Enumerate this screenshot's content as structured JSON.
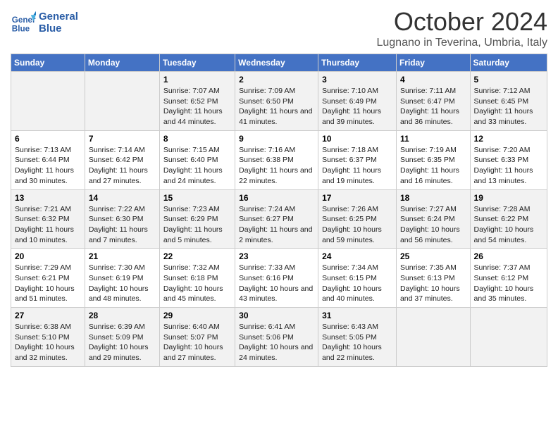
{
  "header": {
    "logo_line1": "General",
    "logo_line2": "Blue",
    "month": "October 2024",
    "location": "Lugnano in Teverina, Umbria, Italy"
  },
  "days_of_week": [
    "Sunday",
    "Monday",
    "Tuesday",
    "Wednesday",
    "Thursday",
    "Friday",
    "Saturday"
  ],
  "weeks": [
    [
      {
        "day": "",
        "info": ""
      },
      {
        "day": "",
        "info": ""
      },
      {
        "day": "1",
        "info": "Sunrise: 7:07 AM\nSunset: 6:52 PM\nDaylight: 11 hours and 44 minutes."
      },
      {
        "day": "2",
        "info": "Sunrise: 7:09 AM\nSunset: 6:50 PM\nDaylight: 11 hours and 41 minutes."
      },
      {
        "day": "3",
        "info": "Sunrise: 7:10 AM\nSunset: 6:49 PM\nDaylight: 11 hours and 39 minutes."
      },
      {
        "day": "4",
        "info": "Sunrise: 7:11 AM\nSunset: 6:47 PM\nDaylight: 11 hours and 36 minutes."
      },
      {
        "day": "5",
        "info": "Sunrise: 7:12 AM\nSunset: 6:45 PM\nDaylight: 11 hours and 33 minutes."
      }
    ],
    [
      {
        "day": "6",
        "info": "Sunrise: 7:13 AM\nSunset: 6:44 PM\nDaylight: 11 hours and 30 minutes."
      },
      {
        "day": "7",
        "info": "Sunrise: 7:14 AM\nSunset: 6:42 PM\nDaylight: 11 hours and 27 minutes."
      },
      {
        "day": "8",
        "info": "Sunrise: 7:15 AM\nSunset: 6:40 PM\nDaylight: 11 hours and 24 minutes."
      },
      {
        "day": "9",
        "info": "Sunrise: 7:16 AM\nSunset: 6:38 PM\nDaylight: 11 hours and 22 minutes."
      },
      {
        "day": "10",
        "info": "Sunrise: 7:18 AM\nSunset: 6:37 PM\nDaylight: 11 hours and 19 minutes."
      },
      {
        "day": "11",
        "info": "Sunrise: 7:19 AM\nSunset: 6:35 PM\nDaylight: 11 hours and 16 minutes."
      },
      {
        "day": "12",
        "info": "Sunrise: 7:20 AM\nSunset: 6:33 PM\nDaylight: 11 hours and 13 minutes."
      }
    ],
    [
      {
        "day": "13",
        "info": "Sunrise: 7:21 AM\nSunset: 6:32 PM\nDaylight: 11 hours and 10 minutes."
      },
      {
        "day": "14",
        "info": "Sunrise: 7:22 AM\nSunset: 6:30 PM\nDaylight: 11 hours and 7 minutes."
      },
      {
        "day": "15",
        "info": "Sunrise: 7:23 AM\nSunset: 6:29 PM\nDaylight: 11 hours and 5 minutes."
      },
      {
        "day": "16",
        "info": "Sunrise: 7:24 AM\nSunset: 6:27 PM\nDaylight: 11 hours and 2 minutes."
      },
      {
        "day": "17",
        "info": "Sunrise: 7:26 AM\nSunset: 6:25 PM\nDaylight: 10 hours and 59 minutes."
      },
      {
        "day": "18",
        "info": "Sunrise: 7:27 AM\nSunset: 6:24 PM\nDaylight: 10 hours and 56 minutes."
      },
      {
        "day": "19",
        "info": "Sunrise: 7:28 AM\nSunset: 6:22 PM\nDaylight: 10 hours and 54 minutes."
      }
    ],
    [
      {
        "day": "20",
        "info": "Sunrise: 7:29 AM\nSunset: 6:21 PM\nDaylight: 10 hours and 51 minutes."
      },
      {
        "day": "21",
        "info": "Sunrise: 7:30 AM\nSunset: 6:19 PM\nDaylight: 10 hours and 48 minutes."
      },
      {
        "day": "22",
        "info": "Sunrise: 7:32 AM\nSunset: 6:18 PM\nDaylight: 10 hours and 45 minutes."
      },
      {
        "day": "23",
        "info": "Sunrise: 7:33 AM\nSunset: 6:16 PM\nDaylight: 10 hours and 43 minutes."
      },
      {
        "day": "24",
        "info": "Sunrise: 7:34 AM\nSunset: 6:15 PM\nDaylight: 10 hours and 40 minutes."
      },
      {
        "day": "25",
        "info": "Sunrise: 7:35 AM\nSunset: 6:13 PM\nDaylight: 10 hours and 37 minutes."
      },
      {
        "day": "26",
        "info": "Sunrise: 7:37 AM\nSunset: 6:12 PM\nDaylight: 10 hours and 35 minutes."
      }
    ],
    [
      {
        "day": "27",
        "info": "Sunrise: 6:38 AM\nSunset: 5:10 PM\nDaylight: 10 hours and 32 minutes."
      },
      {
        "day": "28",
        "info": "Sunrise: 6:39 AM\nSunset: 5:09 PM\nDaylight: 10 hours and 29 minutes."
      },
      {
        "day": "29",
        "info": "Sunrise: 6:40 AM\nSunset: 5:07 PM\nDaylight: 10 hours and 27 minutes."
      },
      {
        "day": "30",
        "info": "Sunrise: 6:41 AM\nSunset: 5:06 PM\nDaylight: 10 hours and 24 minutes."
      },
      {
        "day": "31",
        "info": "Sunrise: 6:43 AM\nSunset: 5:05 PM\nDaylight: 10 hours and 22 minutes."
      },
      {
        "day": "",
        "info": ""
      },
      {
        "day": "",
        "info": ""
      }
    ]
  ]
}
